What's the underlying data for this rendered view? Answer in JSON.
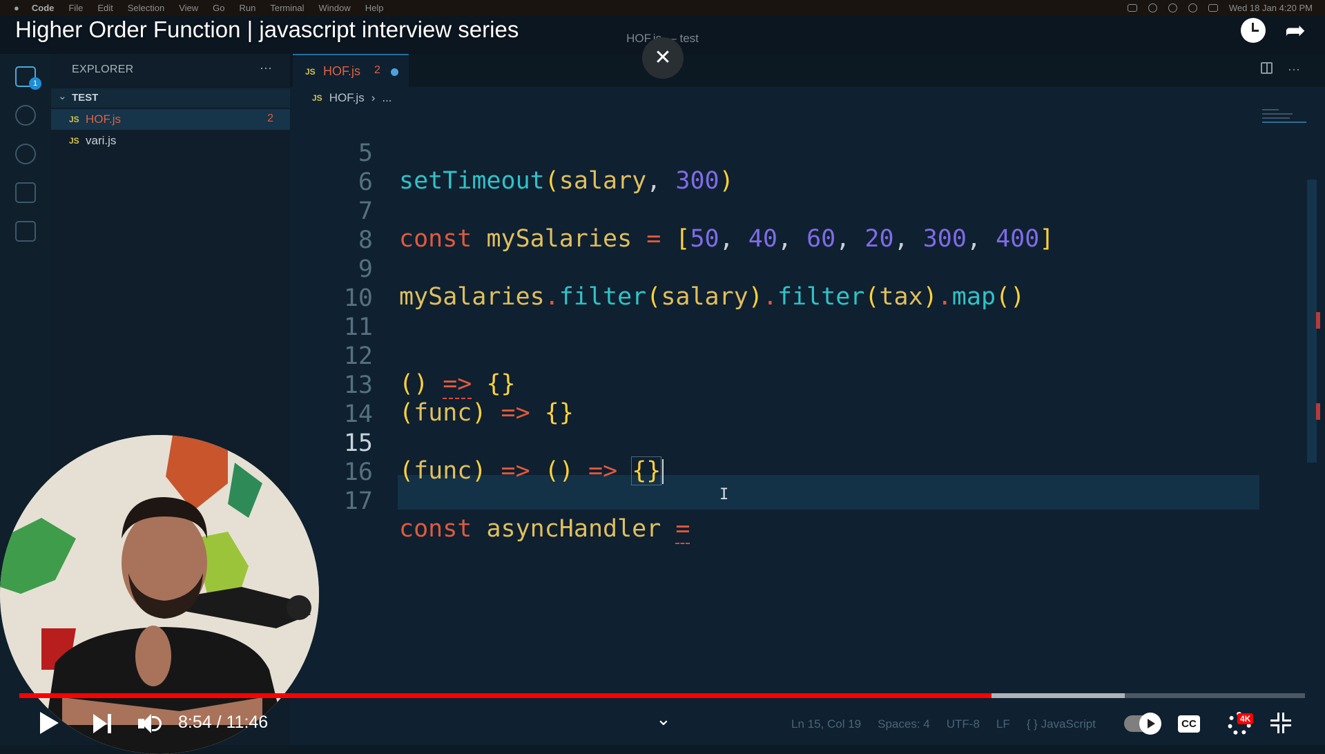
{
  "menubar": {
    "items": [
      "Code",
      "File",
      "Edit",
      "Selection",
      "View",
      "Go",
      "Run",
      "Terminal",
      "Window",
      "Help"
    ],
    "datetime": "Wed 18 Jan  4:20 PM"
  },
  "video": {
    "title": "Higher Order Function | javascript interview series",
    "current_time": "8:54",
    "duration": "11:46",
    "time_display": "8:54 / 11:46",
    "progress_fraction": 0.756,
    "buffer_fraction": 0.86,
    "quality_badge": "4K",
    "cc_label": "CC"
  },
  "editor": {
    "window_title": "HOF.js — test",
    "explorer_title": "EXPLORER",
    "folder": "TEST",
    "files": [
      {
        "name": "HOF.js",
        "badge": "2",
        "active": true
      },
      {
        "name": "vari.js",
        "badge": "",
        "active": false
      }
    ],
    "tab": {
      "name": "HOF.js",
      "badge": "2"
    },
    "breadcrumb": [
      "HOF.js",
      "..."
    ],
    "activity_badge": "1",
    "code_lines": [
      {
        "no": "5",
        "text": "setTimeout(salary, 300)"
      },
      {
        "no": "6",
        "text": ""
      },
      {
        "no": "7",
        "text": "const mySalaries = [50, 40, 60, 20, 300, 400]"
      },
      {
        "no": "8",
        "text": ""
      },
      {
        "no": "9",
        "text": "mySalaries.filter(salary).filter(tax).map()"
      },
      {
        "no": "10",
        "text": ""
      },
      {
        "no": "11",
        "text": ""
      },
      {
        "no": "12",
        "text": "() => {}"
      },
      {
        "no": "13",
        "text": "(func) => {}"
      },
      {
        "no": "14",
        "text": ""
      },
      {
        "no": "15",
        "text": "(func) => () => {}"
      },
      {
        "no": "16",
        "text": ""
      },
      {
        "no": "17",
        "text": "const asyncHandler ="
      }
    ],
    "current_line": "15",
    "status": {
      "position": "Ln 15, Col 19",
      "spaces": "Spaces: 4",
      "encoding": "UTF-8",
      "eol": "LF",
      "language": "{ } JavaScript"
    }
  },
  "colors": {
    "progress": "#ff0000",
    "keyword": "#e05a3d",
    "function": "#2fc3c8",
    "number": "#7f6ce6"
  }
}
